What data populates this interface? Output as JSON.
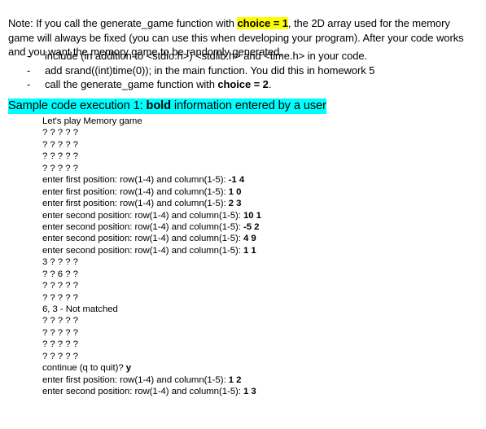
{
  "document": {
    "note": {
      "segments": [
        {
          "text": "Note: If you call the generate_game function with ",
          "style": "normal"
        },
        {
          "text": "choice = 1",
          "style": "highlight-yellow-bold"
        },
        {
          "text": ", the 2D array used for the memory game will always be fixed (you can use this when developing your program). After your code works and you want the memory game to be randomly generated,",
          "style": "normal"
        }
      ],
      "plain": "Note: If you call the generate_game function with choice = 1, the 2D array used for the memory game will always be fixed (you can use this when developing your program). After your code works and you want the memory game to be randomly generated,",
      "prefix": "Note: If you call the generate_game function with ",
      "highlight": "choice = 1",
      "suffix": ", the 2D array used for the memory game will always be fixed (you can use this when developing your program). After your code works and you want the memory game to be randomly generated,"
    },
    "bullets": {
      "marker": "-",
      "items": [
        {
          "text": "include (in addition to <stdio.h>) <stdlib.h> and <time.h> in your code.",
          "prefix": "include (in addition to <stdio.h>) <stdlib.h> and <time.h> in your code.",
          "bold": "",
          "suffix": ""
        },
        {
          "text": "add srand((int)time(0)); in the main function. You did this in homework 5",
          "prefix": "add srand((int)time(0)); in the main function. You did this in homework 5",
          "bold": "",
          "suffix": ""
        },
        {
          "text": "call the generate_game function with choice = 2.",
          "prefix": "call the generate_game function with ",
          "bold": "choice = 2",
          "suffix": "."
        }
      ]
    },
    "sample_heading": {
      "prefix": "Sample code execution 1: ",
      "bold": "bold",
      "suffix": " information entered by a user",
      "plain": "Sample code execution 1: bold information entered by a user",
      "highlight_color": "#00ffff"
    },
    "console": {
      "lines": [
        {
          "text": "Let's play Memory game",
          "bold": ""
        },
        {
          "text": "? ? ? ? ?",
          "bold": ""
        },
        {
          "text": "? ? ? ? ?",
          "bold": ""
        },
        {
          "text": "? ? ? ? ?",
          "bold": ""
        },
        {
          "text": "? ? ? ? ?",
          "bold": ""
        },
        {
          "text": "enter first position: row(1-4) and column(1-5): ",
          "bold": "-1 4"
        },
        {
          "text": "enter first position: row(1-4) and column(1-5): ",
          "bold": "1 0"
        },
        {
          "text": "enter first position: row(1-4) and column(1-5): ",
          "bold": "2 3"
        },
        {
          "text": "enter second position: row(1-4) and column(1-5): ",
          "bold": "10 1"
        },
        {
          "text": "enter second position: row(1-4) and column(1-5): ",
          "bold": "-5 2"
        },
        {
          "text": "enter second position: row(1-4) and column(1-5): ",
          "bold": "4 9"
        },
        {
          "text": "enter second position: row(1-4) and column(1-5): ",
          "bold": "1 1"
        },
        {
          "text": "3 ? ? ? ?",
          "bold": ""
        },
        {
          "text": "? ? 6 ? ?",
          "bold": ""
        },
        {
          "text": "? ? ? ? ?",
          "bold": ""
        },
        {
          "text": "? ? ? ? ?",
          "bold": ""
        },
        {
          "text": "6, 3 - Not matched",
          "bold": ""
        },
        {
          "text": "? ? ? ? ?",
          "bold": ""
        },
        {
          "text": "? ? ? ? ?",
          "bold": ""
        },
        {
          "text": "? ? ? ? ?",
          "bold": ""
        },
        {
          "text": "? ? ? ? ?",
          "bold": ""
        },
        {
          "text": "continue (q to quit)? ",
          "bold": "y"
        },
        {
          "text": "enter first position: row(1-4) and column(1-5): ",
          "bold": "1 2"
        },
        {
          "text": "enter second position: row(1-4) and column(1-5): ",
          "bold": "1 3"
        }
      ]
    },
    "colors": {
      "highlight_yellow": "#ffff00",
      "highlight_cyan": "#00ffff",
      "text": "#000000",
      "background": "#ffffff"
    }
  }
}
